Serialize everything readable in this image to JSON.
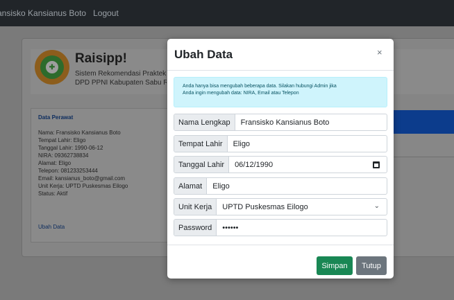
{
  "navbar": {
    "user_name": "ansisko Kansianus Boto",
    "logout_label": "Logout"
  },
  "header": {
    "app_title": "Raisipp!",
    "subtitle_line1": "Sistem Rekomendasi Praktek",
    "subtitle_line2": "DPD PPNI Kabupaten Sabu R"
  },
  "profile": {
    "title": "Data Perawat",
    "lines": [
      "Nama: Fransisko Kansianus Boto",
      "Tempat Lahir: Eligo",
      "Tanggal Lahir: 1990-06-12",
      "NIRA: 09362738834",
      "Alamat: Eligo",
      "Telepon: 081233253444",
      "Email: kansianus_boto@gmail.com",
      "Unit Kerja: UPTD Puskesmas Eilogo",
      "Status: Aktif"
    ],
    "edit_link": "Ubah Data"
  },
  "modal": {
    "title": "Ubah Data",
    "close_symbol": "×",
    "alert_line1": "Anda hanya bisa mengubah beberapa data. Silakan hubungi Admin jika",
    "alert_line2": "Anda ingin mengubah data: NIRA, Email atau Telepon",
    "fields": {
      "nama": {
        "label": "Nama Lengkap",
        "value": "Fransisko Kansianus Boto"
      },
      "tempat": {
        "label": "Tempat Lahir",
        "value": "Eligo"
      },
      "tanggal": {
        "label": "Tanggal Lahir",
        "value": "06/12/1990"
      },
      "alamat": {
        "label": "Alamat",
        "value": "Eligo"
      },
      "unit": {
        "label": "Unit Kerja",
        "value": "UPTD Puskesmas Eilogo"
      },
      "password": {
        "label": "Password",
        "value": "••••••"
      }
    },
    "save_label": "Simpan",
    "close_label": "Tutup"
  },
  "icons": {
    "calendar": "calendar-icon",
    "chevron": "chevron-down-icon",
    "close": "close-icon",
    "logo": "ppni-logo"
  },
  "colors": {
    "primary": "#0d6efd",
    "success": "#198754",
    "secondary": "#6c757d",
    "info_bg": "#cff4fc"
  }
}
